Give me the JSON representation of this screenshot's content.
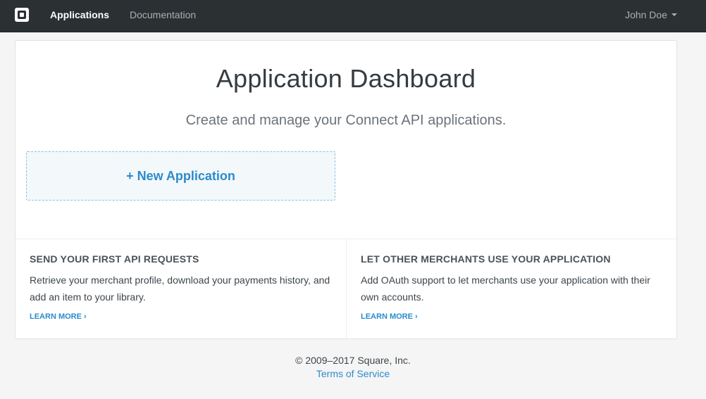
{
  "navbar": {
    "logo_icon": "square-logo-icon",
    "links": [
      {
        "label": "Applications",
        "active": true
      },
      {
        "label": "Documentation",
        "active": false
      }
    ],
    "user": {
      "name": "John Doe",
      "icon": "caret-down-icon"
    }
  },
  "main": {
    "title": "Application Dashboard",
    "subtitle": "Create and manage your Connect API applications.",
    "new_app_label": "+ New Application"
  },
  "panels": [
    {
      "heading": "SEND YOUR FIRST API REQUESTS",
      "text": "Retrieve your merchant profile, download your payments history, and add an item to your library.",
      "link_label": "LEARN MORE"
    },
    {
      "heading": "LET OTHER MERCHANTS USE YOUR APPLICATION",
      "text": "Add OAuth support to let merchants use your application with their own accounts.",
      "link_label": "LEARN MORE"
    }
  ],
  "footer": {
    "copyright": "© 2009–2017 Square, Inc.",
    "terms_label": "Terms of Service"
  },
  "colors": {
    "navbar_bg": "#2b3033",
    "accent_blue": "#2b8bcc",
    "page_bg": "#f5f5f5"
  }
}
